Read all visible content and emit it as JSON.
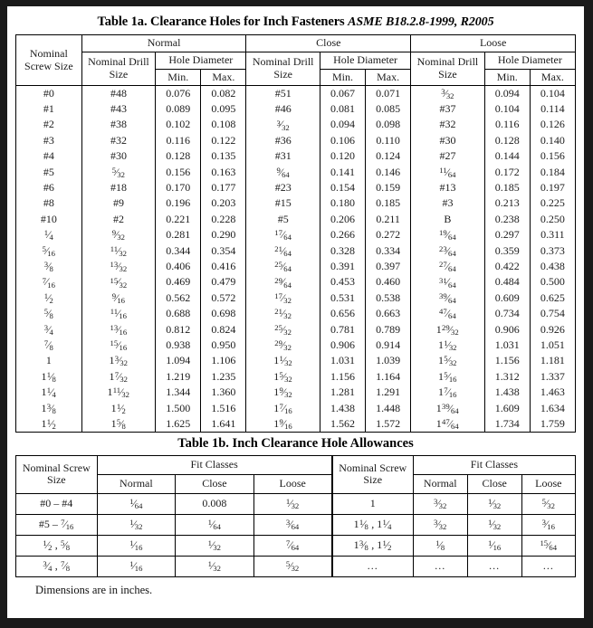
{
  "table1a": {
    "title_main": "Table 1a. Clearance Holes for Inch Fasteners",
    "title_standard": "ASME B18.2.8-1999, R2005",
    "headers": {
      "nominal_screw_size": "Nominal Screw Size",
      "groups": [
        "Normal",
        "Close",
        "Loose"
      ],
      "nominal_drill_size": "Nominal Drill Size",
      "hole_diameter": "Hole Diameter",
      "min": "Min.",
      "max": "Max."
    },
    "rows": [
      {
        "screw": "#0",
        "n_drill": "#48",
        "n_min": "0.076",
        "n_max": "0.082",
        "c_drill": "#51",
        "c_min": "0.067",
        "c_max": "0.071",
        "l_drill": "3/32",
        "l_min": "0.094",
        "l_max": "0.104"
      },
      {
        "screw": "#1",
        "n_drill": "#43",
        "n_min": "0.089",
        "n_max": "0.095",
        "c_drill": "#46",
        "c_min": "0.081",
        "c_max": "0.085",
        "l_drill": "#37",
        "l_min": "0.104",
        "l_max": "0.114"
      },
      {
        "screw": "#2",
        "n_drill": "#38",
        "n_min": "0.102",
        "n_max": "0.108",
        "c_drill": "3/32",
        "c_min": "0.094",
        "c_max": "0.098",
        "l_drill": "#32",
        "l_min": "0.116",
        "l_max": "0.126"
      },
      {
        "screw": "#3",
        "n_drill": "#32",
        "n_min": "0.116",
        "n_max": "0.122",
        "c_drill": "#36",
        "c_min": "0.106",
        "c_max": "0.110",
        "l_drill": "#30",
        "l_min": "0.128",
        "l_max": "0.140"
      },
      {
        "screw": "#4",
        "n_drill": "#30",
        "n_min": "0.128",
        "n_max": "0.135",
        "c_drill": "#31",
        "c_min": "0.120",
        "c_max": "0.124",
        "l_drill": "#27",
        "l_min": "0.144",
        "l_max": "0.156"
      },
      {
        "screw": "#5",
        "n_drill": "5/32",
        "n_min": "0.156",
        "n_max": "0.163",
        "c_drill": "9/64",
        "c_min": "0.141",
        "c_max": "0.146",
        "l_drill": "11/64",
        "l_min": "0.172",
        "l_max": "0.184"
      },
      {
        "screw": "#6",
        "n_drill": "#18",
        "n_min": "0.170",
        "n_max": "0.177",
        "c_drill": "#23",
        "c_min": "0.154",
        "c_max": "0.159",
        "l_drill": "#13",
        "l_min": "0.185",
        "l_max": "0.197"
      },
      {
        "screw": "#8",
        "n_drill": "#9",
        "n_min": "0.196",
        "n_max": "0.203",
        "c_drill": "#15",
        "c_min": "0.180",
        "c_max": "0.185",
        "l_drill": "#3",
        "l_min": "0.213",
        "l_max": "0.225"
      },
      {
        "screw": "#10",
        "n_drill": "#2",
        "n_min": "0.221",
        "n_max": "0.228",
        "c_drill": "#5",
        "c_min": "0.206",
        "c_max": "0.211",
        "l_drill": "B",
        "l_min": "0.238",
        "l_max": "0.250"
      },
      {
        "screw": "1/4",
        "n_drill": "9/32",
        "n_min": "0.281",
        "n_max": "0.290",
        "c_drill": "17/64",
        "c_min": "0.266",
        "c_max": "0.272",
        "l_drill": "19/64",
        "l_min": "0.297",
        "l_max": "0.311"
      },
      {
        "screw": "5/16",
        "n_drill": "11/32",
        "n_min": "0.344",
        "n_max": "0.354",
        "c_drill": "21/64",
        "c_min": "0.328",
        "c_max": "0.334",
        "l_drill": "23/64",
        "l_min": "0.359",
        "l_max": "0.373"
      },
      {
        "screw": "3/8",
        "n_drill": "13/32",
        "n_min": "0.406",
        "n_max": "0.416",
        "c_drill": "25/64",
        "c_min": "0.391",
        "c_max": "0.397",
        "l_drill": "27/64",
        "l_min": "0.422",
        "l_max": "0.438"
      },
      {
        "screw": "7/16",
        "n_drill": "15/32",
        "n_min": "0.469",
        "n_max": "0.479",
        "c_drill": "29/64",
        "c_min": "0.453",
        "c_max": "0.460",
        "l_drill": "31/64",
        "l_min": "0.484",
        "l_max": "0.500"
      },
      {
        "screw": "1/2",
        "n_drill": "9/16",
        "n_min": "0.562",
        "n_max": "0.572",
        "c_drill": "17/32",
        "c_min": "0.531",
        "c_max": "0.538",
        "l_drill": "39/64",
        "l_min": "0.609",
        "l_max": "0.625"
      },
      {
        "screw": "5/8",
        "n_drill": "11/16",
        "n_min": "0.688",
        "n_max": "0.698",
        "c_drill": "21/32",
        "c_min": "0.656",
        "c_max": "0.663",
        "l_drill": "47/64",
        "l_min": "0.734",
        "l_max": "0.754"
      },
      {
        "screw": "3/4",
        "n_drill": "13/16",
        "n_min": "0.812",
        "n_max": "0.824",
        "c_drill": "25/32",
        "c_min": "0.781",
        "c_max": "0.789",
        "l_drill": "1 29/32",
        "l_min": "0.906",
        "l_max": "0.926"
      },
      {
        "screw": "7/8",
        "n_drill": "15/16",
        "n_min": "0.938",
        "n_max": "0.950",
        "c_drill": "29/32",
        "c_min": "0.906",
        "c_max": "0.914",
        "l_drill": "1 1/32",
        "l_min": "1.031",
        "l_max": "1.051"
      },
      {
        "screw": "1",
        "n_drill": "1 3/32",
        "n_min": "1.094",
        "n_max": "1.106",
        "c_drill": "1 1/32",
        "c_min": "1.031",
        "c_max": "1.039",
        "l_drill": "1 5/32",
        "l_min": "1.156",
        "l_max": "1.181"
      },
      {
        "screw": "1 1/8",
        "n_drill": "1 7/32",
        "n_min": "1.219",
        "n_max": "1.235",
        "c_drill": "1 5/32",
        "c_min": "1.156",
        "c_max": "1.164",
        "l_drill": "1 5/16",
        "l_min": "1.312",
        "l_max": "1.337"
      },
      {
        "screw": "1 1/4",
        "n_drill": "1 11/32",
        "n_min": "1.344",
        "n_max": "1.360",
        "c_drill": "1 9/32",
        "c_min": "1.281",
        "c_max": "1.291",
        "l_drill": "1 7/16",
        "l_min": "1.438",
        "l_max": "1.463"
      },
      {
        "screw": "1 3/8",
        "n_drill": "1 1/2",
        "n_min": "1.500",
        "n_max": "1.516",
        "c_drill": "1 7/16",
        "c_min": "1.438",
        "c_max": "1.448",
        "l_drill": "1 39/64",
        "l_min": "1.609",
        "l_max": "1.634"
      },
      {
        "screw": "1 1/2",
        "n_drill": "1 5/8",
        "n_min": "1.625",
        "n_max": "1.641",
        "c_drill": "1 9/16",
        "c_min": "1.562",
        "c_max": "1.572",
        "l_drill": "1 47/64",
        "l_min": "1.734",
        "l_max": "1.759"
      }
    ]
  },
  "table1b": {
    "title": "Table 1b. Inch Clearance Hole Allowances",
    "headers": {
      "nominal_screw_size": "Nominal Screw Size",
      "fit_classes": "Fit Classes",
      "normal": "Normal",
      "close": "Close",
      "loose": "Loose"
    },
    "rows_left": [
      {
        "screw": "#0 – #4",
        "normal": "1/64",
        "close": "0.008",
        "loose": "1/32"
      },
      {
        "screw": "#5 – 7/16",
        "normal": "1/32",
        "close": "1/64",
        "loose": "3/64"
      },
      {
        "screw": "1/2 , 5/8",
        "normal": "1/16",
        "close": "1/32",
        "loose": "7/64"
      },
      {
        "screw": "3/4 , 7/8",
        "normal": "1/16",
        "close": "1/32",
        "loose": "5/32"
      }
    ],
    "rows_right": [
      {
        "screw": "1",
        "normal": "3/32",
        "close": "1/32",
        "loose": "5/32"
      },
      {
        "screw": "1 1/8 , 1 1/4",
        "normal": "3/32",
        "close": "1/32",
        "loose": "3/16"
      },
      {
        "screw": "1 3/8 , 1 1/2",
        "normal": "1/8",
        "close": "1/16",
        "loose": "15/64"
      },
      {
        "screw": "…",
        "normal": "…",
        "close": "…",
        "loose": "…"
      }
    ]
  },
  "footnote": "Dimensions are in inches."
}
